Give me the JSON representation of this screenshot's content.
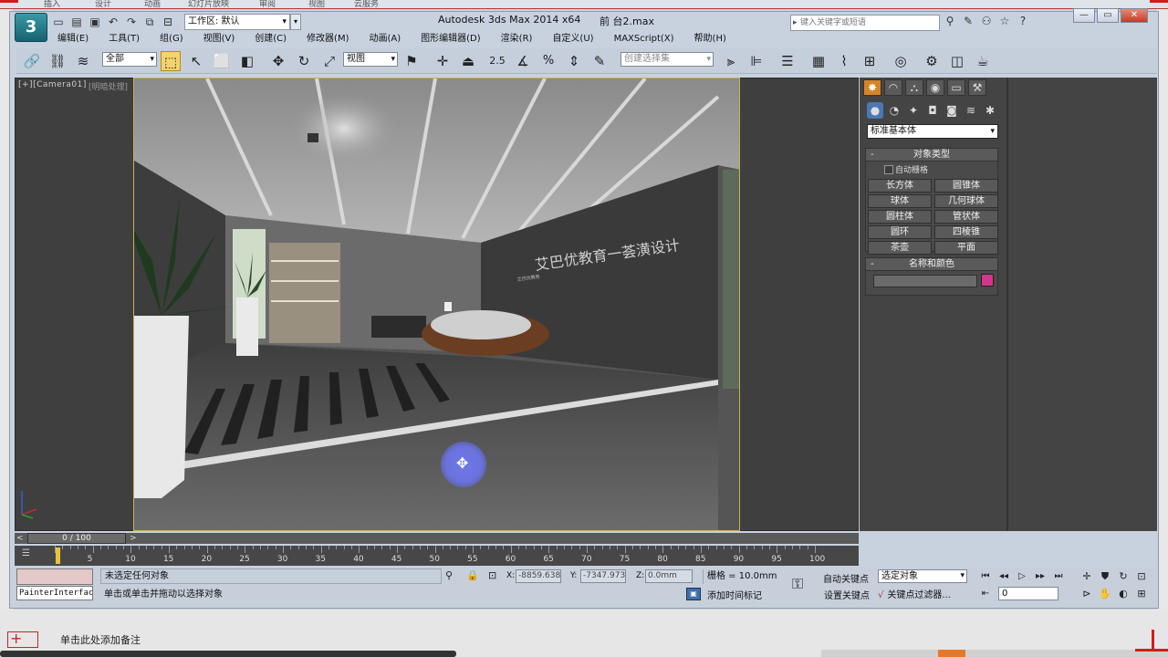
{
  "background_ribbon": [
    "插入",
    "设计",
    "动画",
    "幻灯片放映",
    "审阅",
    "视图",
    "云服务"
  ],
  "ppt": {
    "notes_placeholder": "单击此处添加备注",
    "add_symbol": "+"
  },
  "titlebar": {
    "logo_glyph": "3",
    "workspace": "工作区: 默认",
    "app_title": "Autodesk 3ds Max  2014 x64",
    "file_title": "前 台2.max",
    "search_placeholder": "键入关键字或短语",
    "window_controls": [
      "—",
      "▭",
      "✕"
    ]
  },
  "menu": [
    "编辑(E)",
    "工具(T)",
    "组(G)",
    "视图(V)",
    "创建(C)",
    "修改器(M)",
    "动画(A)",
    "图形编辑器(D)",
    "渲染(R)",
    "自定义(U)",
    "MAXScript(X)",
    "帮助(H)"
  ],
  "toolbar": {
    "filter_selection": "全部",
    "coord_system": "视图",
    "named_selection_placeholder": "创建选择集",
    "snap_value": "2.5",
    "percent_snap": "%"
  },
  "viewport": {
    "label": "[+][Camera01]",
    "shading": "[明暗处理]",
    "signage": "艾巴优教育一荟潢设计",
    "logo_small": "艾巴优教育"
  },
  "command_panel": {
    "category": "标准基本体",
    "object_type_title": "对象类型",
    "autogrid": "自动栅格",
    "primitives": [
      "长方体",
      "圆锥体",
      "球体",
      "几何球体",
      "圆柱体",
      "管状体",
      "圆环",
      "四棱锥",
      "茶壶",
      "平面"
    ],
    "name_color_title": "名称和颜色",
    "object_color": "#d4368c"
  },
  "timeline": {
    "slider": "0 / 100",
    "ticks": [
      0,
      5,
      10,
      15,
      20,
      25,
      30,
      35,
      40,
      45,
      50,
      55,
      60,
      65,
      70,
      75,
      80,
      85,
      90,
      95,
      100
    ],
    "current_frame": 0,
    "frame_count": 100
  },
  "status": {
    "listener": "PainterInterface",
    "selection": "未选定任何对象",
    "prompt": "单击或单击并拖动以选择对象",
    "x_label": "X:",
    "x_value": "-8859.638",
    "y_label": "Y:",
    "y_value": "-7347.973",
    "z_label": "Z:",
    "z_value": "0.0mm",
    "grid": "栅格 = 10.0mm",
    "add_time_tag": "添加时间标记",
    "auto_key": "自动关键点",
    "set_key": "设置关键点",
    "key_mode": "选定对象",
    "key_filters": "关键点过滤器...",
    "frame": "0"
  },
  "colors": {
    "accent_selected": "#f3d36b",
    "active_tab": "#d58526",
    "viewport_border": "#c9b24a"
  }
}
